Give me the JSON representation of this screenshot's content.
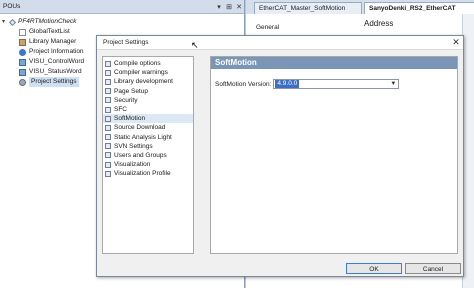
{
  "pous": {
    "header": "POUs",
    "controls": [
      "▾",
      "⊞",
      "✕"
    ],
    "tree": [
      {
        "label": "PF4RTMotionCheck",
        "icon": "project-icon"
      },
      {
        "label": "GlobalTextList",
        "icon": "text-list-icon"
      },
      {
        "label": "Library Manager",
        "icon": "library-icon"
      },
      {
        "label": "Project Information",
        "icon": "info-icon"
      },
      {
        "label": "VISU_ControlWord",
        "icon": "visu-icon"
      },
      {
        "label": "VISU_StatusWord",
        "icon": "visu-icon"
      },
      {
        "label": "Project Settings",
        "icon": "settings-icon"
      }
    ]
  },
  "editor": {
    "tabs": [
      "EtherCAT_Master_SoftMotion",
      "SanyoDenki_RS2_EtherCAT"
    ],
    "general": "General",
    "address": "Address"
  },
  "dialog": {
    "title": "Project Settings",
    "close": "✕",
    "categories": [
      "Compile options",
      "Compiler warnings",
      "Library development",
      "Page Setup",
      "Security",
      "SFC",
      "SoftMotion",
      "Source Download",
      "Static Analysis Light",
      "SVN Settings",
      "Users and Groups",
      "Visualization",
      "Visualization Profile"
    ],
    "selected_category": "SoftMotion",
    "content_title": "SoftMotion",
    "softmotion_label": "SoftMotion Version:",
    "softmotion_value": "4.9.0.0",
    "ok": "OK",
    "cancel": "Cancel"
  }
}
